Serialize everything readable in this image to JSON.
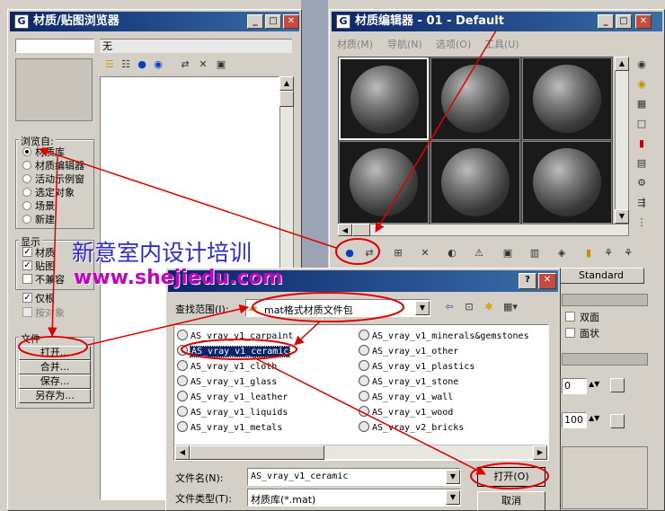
{
  "browser_window": {
    "title": "材质/贴图浏览器",
    "name_value": "无",
    "browse_from": {
      "label": "浏览自:",
      "options": [
        "材质库",
        "材质编辑器",
        "活动示例窗",
        "选定对象",
        "场景",
        "新建"
      ],
      "selected": 0
    },
    "show": {
      "label": "显示",
      "items": [
        "材质",
        "贴图",
        "不兼容"
      ],
      "checked": [
        true,
        true,
        false
      ]
    },
    "only_root": "仅根",
    "by_object": "按对象",
    "file": {
      "label": "文件",
      "buttons": [
        "打开...",
        "合并...",
        "保存...",
        "另存为..."
      ]
    }
  },
  "editor_window": {
    "title": "材质编辑器 - 01 - Default",
    "menu": [
      "材质(M)",
      "导航(N)",
      "选项(O)",
      "工具(U)"
    ],
    "standard_label": "Standard",
    "two_sided": "双面",
    "faceted": "面状",
    "spinner1": "0",
    "spinner2": "100"
  },
  "open_dialog": {
    "help": "?",
    "close": "✕",
    "look_in_label": "查找范围(I):",
    "look_in_value": "mat格式材质文件包",
    "files_left": [
      "AS_vray_v1_carpaint",
      "AS_vray_v1_ceramic",
      "AS_vray_v1_cloth",
      "AS_vray_v1_glass",
      "AS_vray_v1_leather",
      "AS_vray_v1_liquids",
      "AS_vray_v1_metals"
    ],
    "files_right": [
      "AS_vray_v1_minerals&gemstones",
      "AS_vray_v1_other",
      "AS_vray_v1_plastics",
      "AS_vray_v1_stone",
      "AS_vray_v1_wall",
      "AS_vray_v1_wood",
      "AS_vray_v2_bricks"
    ],
    "selected_file": "AS_vray_v1_ceramic",
    "filename_label": "文件名(N):",
    "filename_value": "AS_vray_v1_ceramic",
    "filetype_label": "文件类型(T):",
    "filetype_value": "材质库(*.mat)",
    "open_button": "打开(O)",
    "cancel_button": "取消"
  },
  "watermark": {
    "line1": "新意室内设计培训",
    "line2": "www.shejiedu.com"
  },
  "colors": {
    "annotation_red": "#e00000",
    "title_start": "#0a246a",
    "title_end": "#3a6ea5",
    "watermark_blue": "#2b2bd0",
    "watermark_magenta": "#c400c4"
  },
  "icons": {
    "get_material": "get-material-icon",
    "put_to_scene": "put-to-scene-icon"
  }
}
